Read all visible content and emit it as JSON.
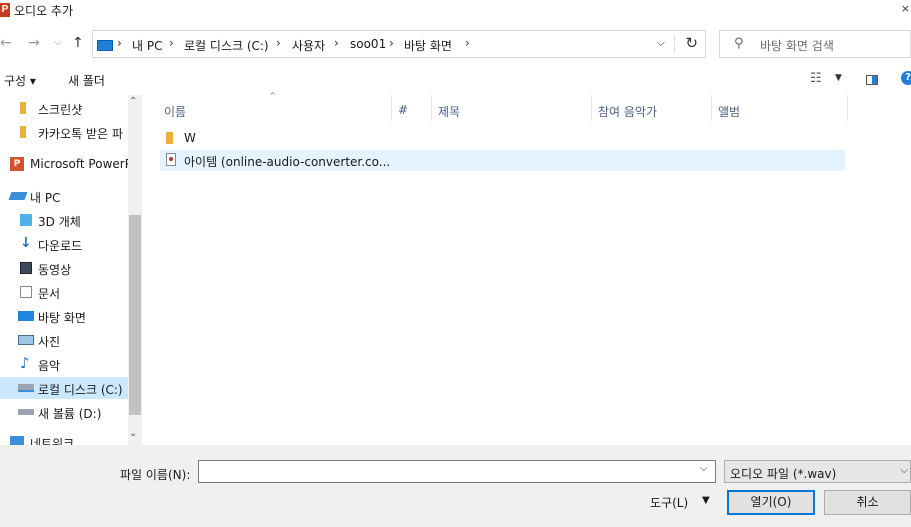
{
  "window": {
    "title": "오디오 추가",
    "app_icon_letter": "P"
  },
  "nav": {
    "breadcrumbs": [
      "내 PC",
      "로컬 디스크 (C:)",
      "사용자",
      "soo01",
      "바탕 화면"
    ],
    "search_placeholder": "바탕 화면 검색"
  },
  "toolbar": {
    "organize": "구성 ▾",
    "new_folder": "새 폴더"
  },
  "sidebar": {
    "items": [
      {
        "label": "스크린샷",
        "icon": "folder-icon"
      },
      {
        "label": "카카오톡 받은 파",
        "icon": "folder-icon"
      },
      {
        "label": "Microsoft PowerP",
        "icon": "powerpoint-icon"
      },
      {
        "label": "내 PC",
        "icon": "pc-icon"
      },
      {
        "label": "3D 개체",
        "icon": "3d-objects-icon"
      },
      {
        "label": "다운로드",
        "icon": "download-icon"
      },
      {
        "label": "동영상",
        "icon": "video-icon"
      },
      {
        "label": "문서",
        "icon": "document-icon"
      },
      {
        "label": "바탕 화면",
        "icon": "desktop-icon"
      },
      {
        "label": "사진",
        "icon": "pictures-icon"
      },
      {
        "label": "음악",
        "icon": "music-icon"
      },
      {
        "label": "로컬 디스크 (C:)",
        "icon": "drive-c-icon",
        "selected": true
      },
      {
        "label": "새 볼륨 (D:)",
        "icon": "drive-d-icon"
      },
      {
        "label": "네트워크",
        "icon": "network-icon"
      }
    ]
  },
  "columns": [
    "이름",
    "#",
    "제목",
    "참여 음악가",
    "앨범"
  ],
  "files": [
    {
      "name": "W",
      "type": "folder"
    },
    {
      "name": "아이템 (online-audio-converter.co...",
      "type": "audio",
      "selected": true
    }
  ],
  "bottom": {
    "filename_label": "파일 이름(N):",
    "filename_value": "",
    "filetype": "오디오 파일 (*.wav)",
    "tools": "도구(L)",
    "open": "열기(O)",
    "cancel": "취소"
  },
  "colors": {
    "selected_bg": "#cce8ff",
    "row_selected_bg": "#e5f3ff",
    "accent": "#0078d7"
  }
}
